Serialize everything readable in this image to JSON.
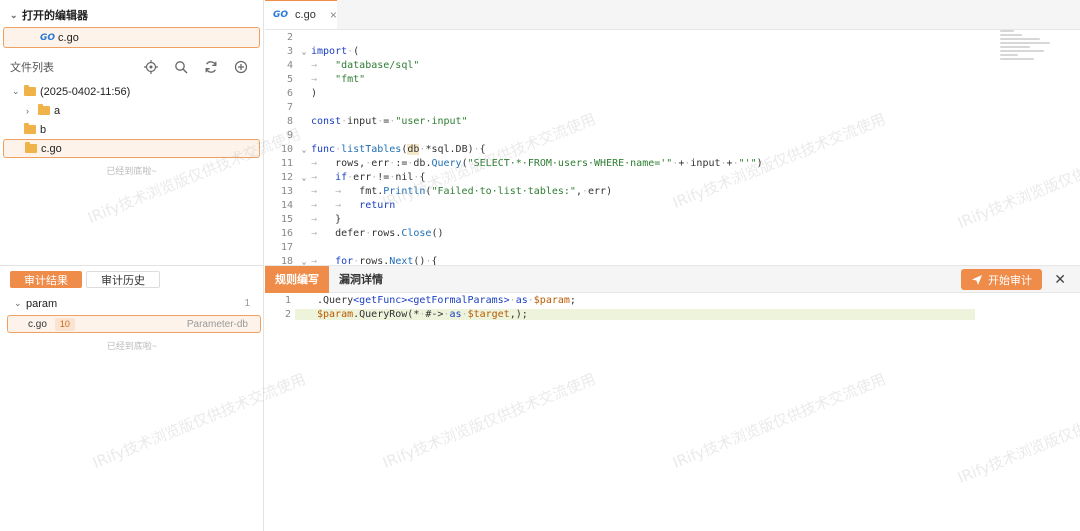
{
  "sidebar": {
    "open_editors_title": "打开的编辑器",
    "open_file": {
      "badge": "GO",
      "name": "c.go"
    },
    "files_title": "文件列表",
    "tree": [
      {
        "label": "(2025-0402-11:56)",
        "type": "folder",
        "expanded": true
      },
      {
        "label": "a",
        "type": "folder",
        "expanded": false
      },
      {
        "label": "b",
        "type": "folder"
      },
      {
        "label": "c.go",
        "type": "file",
        "selected": true
      }
    ],
    "end_hint": "已经到底啦~"
  },
  "audit": {
    "tabs": [
      "审计结果",
      "审计历史"
    ],
    "group": {
      "label": "param",
      "count": "1"
    },
    "result": {
      "file": "c.go",
      "line": "10",
      "rule": "Parameter-db"
    },
    "end_hint": "已经到底啦~"
  },
  "editor": {
    "tab": {
      "badge": "GO",
      "name": "c.go"
    }
  },
  "rules": {
    "tabs": [
      "规则编写",
      "漏洞详情"
    ],
    "run_label": "开始审计"
  },
  "watermark": "IRify技术浏览版仅供技术交流使用",
  "colors": {
    "accent": "#f08c4a",
    "go_blue": "#2b7bd6"
  }
}
